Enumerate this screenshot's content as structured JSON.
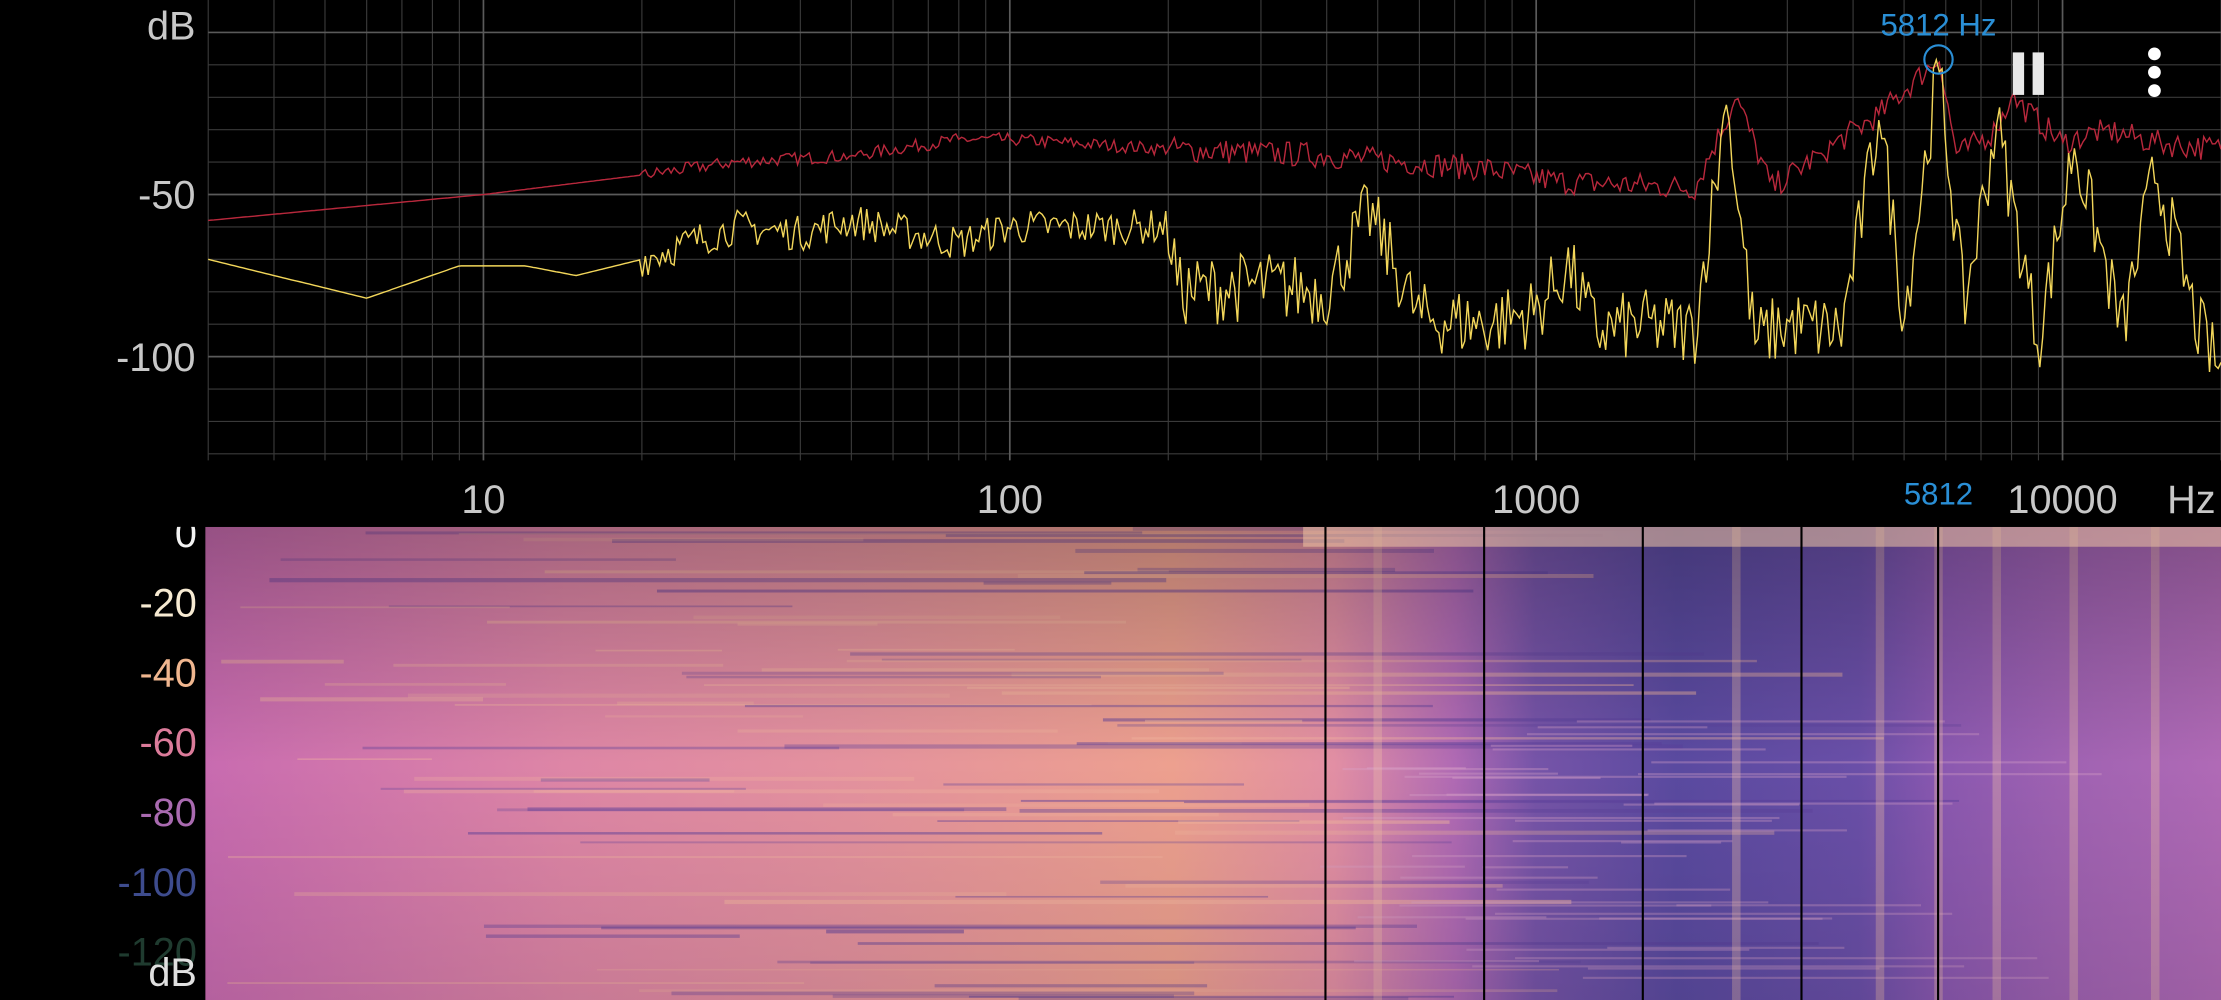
{
  "spectrum": {
    "unit_top": "dB",
    "y_ticks": [
      {
        "value": -50,
        "label": "-50"
      },
      {
        "value": -100,
        "label": "-100"
      }
    ],
    "y_range": [
      -132,
      10
    ],
    "x_unit": "Hz",
    "x_ticks": [
      {
        "value": 10,
        "label": "10"
      },
      {
        "value": 100,
        "label": "100"
      },
      {
        "value": 1000,
        "label": "1000"
      },
      {
        "value": 10000,
        "label": "10000"
      }
    ],
    "x_range": [
      3,
      20000
    ],
    "log_scale": true,
    "grid": true,
    "cursor": {
      "freq_hz": 5812,
      "label": "5812 Hz",
      "axis_label": "5812"
    },
    "colors": {
      "peak_hold": "#b8283c",
      "live": "#f2d65a",
      "cursor": "#2a8fd6",
      "grid": "#3a3a3a",
      "tick_text": "#c8c8c8"
    }
  },
  "chart_data": {
    "type": "line",
    "x_scale": "log",
    "xlabel": "Hz",
    "ylabel": "dB",
    "xlim": [
      3,
      20000
    ],
    "ylim": [
      -132,
      10
    ],
    "series": [
      {
        "x": [
          3,
          10,
          20,
          30,
          50,
          80,
          100,
          200,
          400,
          800,
          1100,
          1500,
          2000,
          2400,
          2800,
          3500,
          4500,
          5812,
          6300,
          7500,
          8000,
          10000,
          12000,
          15000,
          20000
        ],
        "values": [
          -58,
          -50,
          -44,
          -40,
          -38,
          -33,
          -33,
          -36,
          -38,
          -42,
          -46,
          -47,
          -48,
          -20,
          -48,
          -37,
          -25,
          -8,
          -38,
          -30,
          -20,
          -34,
          -30,
          -34,
          -36
        ]
      },
      {
        "x": [
          3,
          6,
          9,
          12,
          15,
          20,
          30,
          40,
          50,
          80,
          100,
          200,
          210,
          300,
          400,
          480,
          600,
          800,
          1000,
          1150,
          1300,
          1600,
          2000,
          2300,
          2600,
          3000,
          3800,
          4500,
          5000,
          5812,
          6500,
          7500,
          9000,
          10500,
          13000,
          15000,
          18000,
          20000
        ],
        "values": [
          -70,
          -82,
          -72,
          -72,
          -75,
          -70,
          -60,
          -62,
          -58,
          -65,
          -60,
          -60,
          -80,
          -78,
          -80,
          -55,
          -88,
          -90,
          -86,
          -72,
          -92,
          -90,
          -92,
          -22,
          -95,
          -90,
          -92,
          -25,
          -88,
          -10,
          -85,
          -28,
          -95,
          -35,
          -92,
          -42,
          -90,
          -105
        ]
      }
    ]
  },
  "spectrogram": {
    "y_ticks": [
      {
        "value": 0,
        "label": "0",
        "color": "#f3f3f3"
      },
      {
        "value": -20,
        "label": "-20",
        "color": "#f6ead2"
      },
      {
        "value": -40,
        "label": "-40",
        "color": "#f0b68f"
      },
      {
        "value": -60,
        "label": "-60",
        "color": "#db7b9a"
      },
      {
        "value": -80,
        "label": "-80",
        "color": "#a96ab0"
      },
      {
        "value": -100,
        "label": "-100",
        "color": "#3e4c8e"
      },
      {
        "value": -120,
        "label": "-120",
        "color": "#1f3b2f"
      }
    ],
    "unit": "dB",
    "marker_freqs_hz": [
      400,
      800,
      1600,
      3200,
      5812
    ]
  },
  "controls": {
    "pause": {
      "icon": "pause-icon"
    },
    "menu": {
      "icon": "more-vertical-icon"
    }
  }
}
